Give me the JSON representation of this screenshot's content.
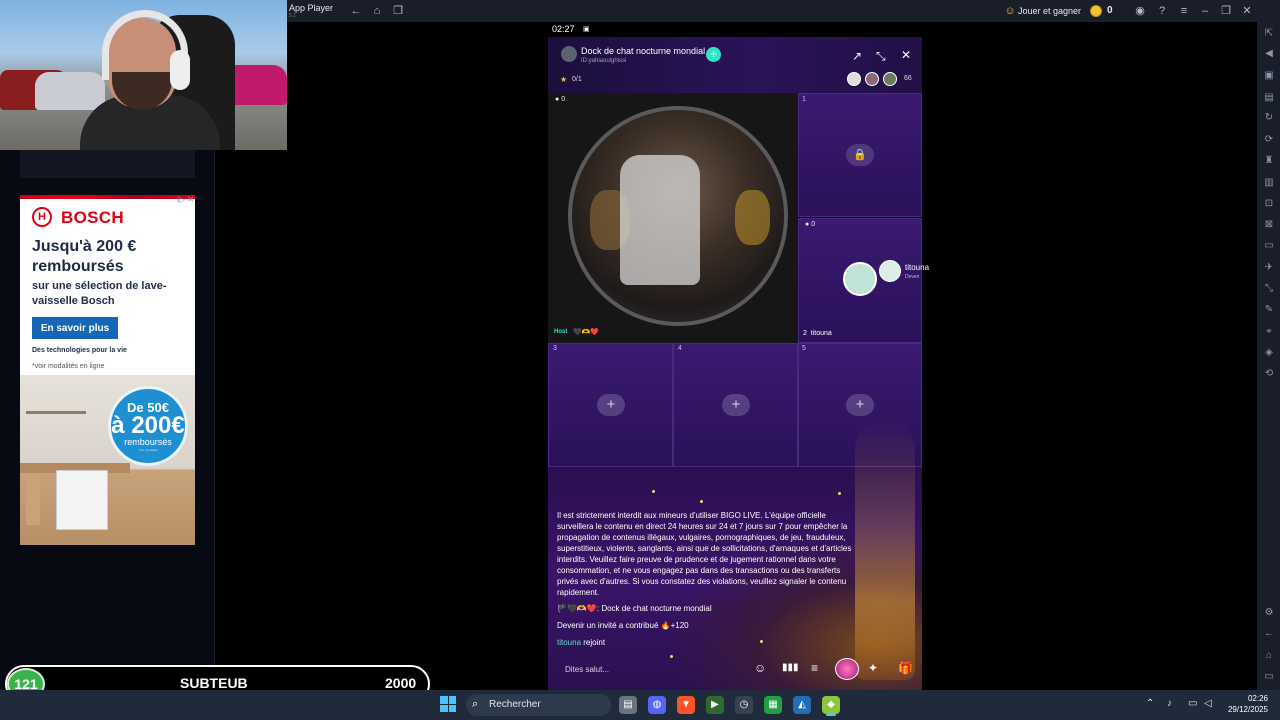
{
  "webcam": {
    "label": "webcam-overlay"
  },
  "ad": {
    "brand": "BOSCH",
    "headline": "Jusqu'à 200 € remboursés",
    "subline": "sur une sélection de lave-vaisselle Bosch",
    "cta": "En savoir plus",
    "tagline": "Des technologies pour la vie",
    "note": "*voir modalités en ligne",
    "badge_from": "De 50€",
    "badge_to": "à 200€",
    "badge_label": "remboursés",
    "badge_fine": "*voir modalités",
    "close": "i▷ ✕"
  },
  "goal_bar": {
    "count": "121",
    "label": "SUBTEUB",
    "goal": "2000"
  },
  "app_player": {
    "title": "App Player",
    "subtitle": "5.1",
    "promo": "Jouer et gagner",
    "coins": "0"
  },
  "phone": {
    "status_time": "02:27",
    "room_title": "Dock de chat nocturne mondial",
    "room_id": "ID:yahiaoulghissi",
    "stats": "0/1",
    "viewers": "66",
    "host_coins": "0",
    "host_tag": "Host",
    "host_emojis": "🖤🫶❤️",
    "seats": [
      {
        "number": "1",
        "state": "locked"
      },
      {
        "number": "2",
        "state": "occupied",
        "coins": "0",
        "name": "titouna",
        "sub": "Deven"
      },
      {
        "number": "3",
        "state": "empty"
      },
      {
        "number": "4",
        "state": "empty"
      },
      {
        "number": "5",
        "state": "empty"
      }
    ],
    "guest_label": "titouna",
    "notice": "Il est strictement interdit aux mineurs d'utiliser BIGO LIVE. L'équipe officielle surveillera le contenu en direct 24 heures sur 24 et 7 jours sur 7 pour empêcher la propagation de contenus illégaux, vulgaires, pornographiques, de jeu, frauduleux, superstitieux, violents, sanglants, ainsi que de sollicitations, d'arnaques et d'articles interdits. Veuillez faire preuve de prudence et de jugement rationnel dans votre consommation, et ne vous engagez pas dans des transactions ou des transferts privés avec d'autres. Si vous constatez des violations, veuillez signaler le contenu rapidement.",
    "chat_line1_prefix": "🏴🖤🫶❤️:",
    "chat_line1": "Dock de chat nocturne mondial",
    "chat_line2": "Devenir un invité a contribué 🔥+120",
    "chat_line3_name": "titouna",
    "chat_line3": "rejoint",
    "input_placeholder": "Dites salut..."
  },
  "taskbar": {
    "search": "Rechercher",
    "time": "02:26",
    "date": "29/12/2025"
  },
  "colors": {
    "accent": "#2ee6c5",
    "room_purple": "#3a1a72",
    "bosch_red": "#e20015",
    "bosch_blue": "#1466b7"
  }
}
